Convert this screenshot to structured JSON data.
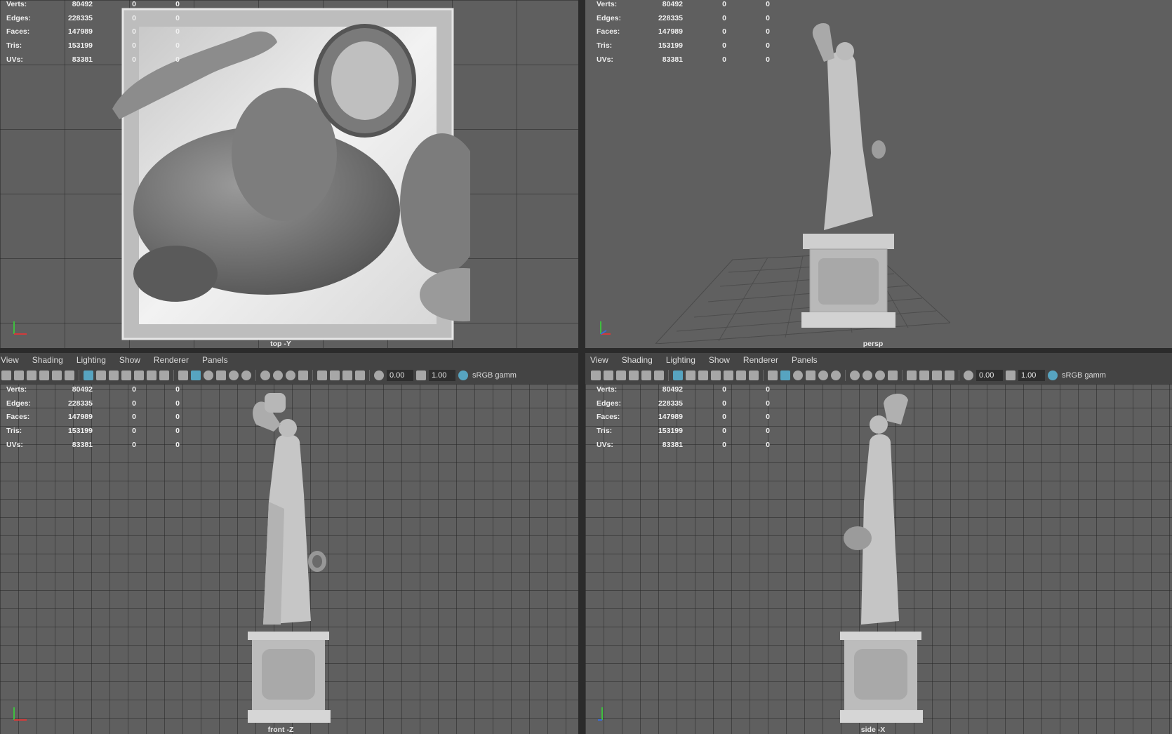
{
  "stats": {
    "labels": [
      "Verts:",
      "Edges:",
      "Faces:",
      "Tris:",
      "UVs:"
    ],
    "values": [
      "80492",
      "228335",
      "147989",
      "153199",
      "83381"
    ],
    "col2": [
      "0",
      "0",
      "0",
      "0",
      "0"
    ],
    "col3": [
      "0",
      "0",
      "0",
      "0",
      "0"
    ]
  },
  "panel_menu": {
    "view": "View",
    "shading": "Shading",
    "lighting": "Lighting",
    "show": "Show",
    "renderer": "Renderer",
    "panels": "Panels"
  },
  "panel_toolbar": {
    "exposure": "0.00",
    "gamma": "1.00",
    "color_space": "sRGB gamm"
  },
  "viewports": {
    "top": {
      "camera": "top -Y"
    },
    "persp": {
      "camera": "persp"
    },
    "front": {
      "camera": "front -Z"
    },
    "side": {
      "camera": "side -X"
    }
  },
  "colors": {
    "viewport_bg": "#5f5f5f",
    "grid_line": "#3a3a3a",
    "panel_bg": "#444444",
    "toolbar_highlight": "#5bb5d6",
    "model": "#cfcfcf"
  },
  "icons": [
    "camera-icon",
    "bookmark-icon",
    "grid-icon",
    "wireframe-icon",
    "shaded-icon",
    "textured-icon",
    "light-icon",
    "shadow-icon",
    "xray-icon",
    "isolate-icon",
    "exposure-icon",
    "gamma-icon",
    "color-management-icon"
  ]
}
